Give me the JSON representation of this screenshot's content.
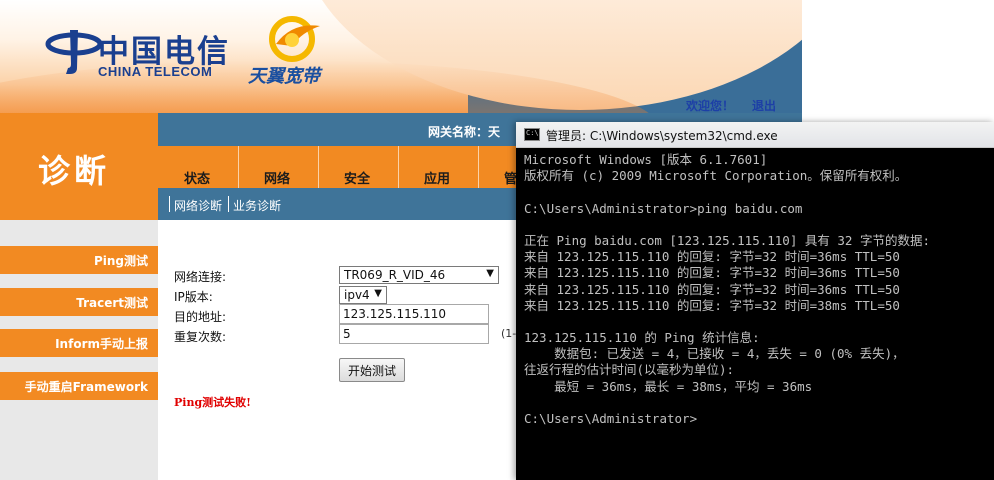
{
  "router": {
    "header": {
      "brand_cn": "中国电信",
      "brand_en": "CHINA TELECOM",
      "product_name": "天翼宽带",
      "welcome_link": "欢迎您！",
      "logout_link": "退出"
    },
    "gateway_label": "网关名称：天",
    "sidebar": {
      "title": "诊断",
      "items": [
        {
          "label": "Ping测试"
        },
        {
          "label": "Tracert测试"
        },
        {
          "label": "Inform手动上报"
        },
        {
          "label": "手动重启Framework"
        }
      ]
    },
    "nav": {
      "tabs": [
        {
          "label": "状态"
        },
        {
          "label": "网络"
        },
        {
          "label": "安全"
        },
        {
          "label": "应用"
        },
        {
          "label": "管"
        }
      ]
    },
    "subnav": {
      "items": [
        {
          "label": "网络诊断"
        },
        {
          "label": "业务诊断"
        }
      ]
    },
    "form": {
      "connection_label": "网络连接:",
      "connection_value": "TR069_R_VID_46",
      "ipver_label": "IP版本:",
      "ipver_value": "ipv4",
      "dest_label": "目的地址:",
      "dest_value": "123.125.115.110",
      "repeat_label": "重复次数:",
      "repeat_value": "5",
      "repeat_hint": "(1-",
      "start_button": "开始测试",
      "fail_message": "Ping测试失败!"
    }
  },
  "cmd": {
    "title": "管理员: C:\\Windows\\system32\\cmd.exe",
    "lines": [
      "Microsoft Windows [版本 6.1.7601]",
      "版权所有 (c) 2009 Microsoft Corporation。保留所有权利。",
      "",
      "C:\\Users\\Administrator>ping baidu.com",
      "",
      "正在 Ping baidu.com [123.125.115.110] 具有 32 字节的数据:",
      "来自 123.125.115.110 的回复: 字节=32 时间=36ms TTL=50",
      "来自 123.125.115.110 的回复: 字节=32 时间=36ms TTL=50",
      "来自 123.125.115.110 的回复: 字节=32 时间=36ms TTL=50",
      "来自 123.125.115.110 的回复: 字节=32 时间=38ms TTL=50",
      "",
      "123.125.115.110 的 Ping 统计信息:",
      "    数据包: 已发送 = 4，已接收 = 4，丢失 = 0 (0% 丢失)，",
      "往返行程的估计时间(以毫秒为单位):",
      "    最短 = 36ms，最长 = 38ms，平均 = 36ms",
      "",
      "C:\\Users\\Administrator>"
    ]
  },
  "colors": {
    "orange": "#f28a22",
    "steel_blue": "#3f7499",
    "brand_blue": "#1a3f8f",
    "error_red": "#e00000",
    "console_text": "#c0c0c0"
  },
  "icons": [
    "china-telecom-logo",
    "tianyi-logo",
    "cmd-window-icon",
    "dropdown-arrow-icon"
  ]
}
